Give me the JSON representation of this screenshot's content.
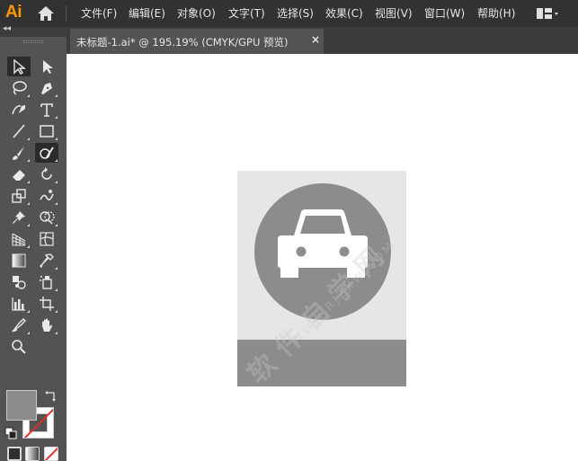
{
  "app": {
    "logo_text": "Ai",
    "home_icon": "home-icon"
  },
  "menu": {
    "items": [
      {
        "label": "文件(F)"
      },
      {
        "label": "编辑(E)"
      },
      {
        "label": "对象(O)"
      },
      {
        "label": "文字(T)"
      },
      {
        "label": "选择(S)"
      },
      {
        "label": "效果(C)"
      },
      {
        "label": "视图(V)"
      },
      {
        "label": "窗口(W)"
      },
      {
        "label": "帮助(H)"
      }
    ],
    "workspace_icon": "workspace-switcher-icon"
  },
  "toolpanel": {
    "collapse_label": "◂◂",
    "tools": [
      {
        "name": "selection-tool",
        "selected": true
      },
      {
        "name": "direct-selection-tool"
      },
      {
        "name": "magic-wand-tool"
      },
      {
        "name": "pen-tool"
      },
      {
        "name": "curvature-tool"
      },
      {
        "name": "type-tool"
      },
      {
        "name": "line-segment-tool"
      },
      {
        "name": "rectangle-tool"
      },
      {
        "name": "paintbrush-tool"
      },
      {
        "name": "shaper-tool",
        "selected": true
      },
      {
        "name": "eraser-tool"
      },
      {
        "name": "rotate-tool"
      },
      {
        "name": "scale-tool"
      },
      {
        "name": "warp-tool"
      },
      {
        "name": "puppet-warp-tool"
      },
      {
        "name": "shape-builder-tool"
      },
      {
        "name": "perspective-grid-tool"
      },
      {
        "name": "mesh-tool"
      },
      {
        "name": "gradient-tool"
      },
      {
        "name": "eyedropper-tool"
      },
      {
        "name": "blend-tool"
      },
      {
        "name": "symbol-sprayer-tool"
      },
      {
        "name": "column-graph-tool"
      },
      {
        "name": "artboard-tool"
      },
      {
        "name": "slice-tool"
      },
      {
        "name": "hand-tool"
      },
      {
        "name": "zoom-tool"
      }
    ],
    "fill_color": "#8c8c8c",
    "stroke_color": "none"
  },
  "document": {
    "tab_label": "未标题-1.ai* @ 195.19% (CMYK/GPU 预览)",
    "close_label": "×"
  },
  "artwork": {
    "artboard_color": "#e6e6e6",
    "shape_color": "#8c8c8c",
    "icon": "car-icon"
  },
  "watermark": {
    "main": "软件自学网",
    "sub": "WWW.RJZXW.COM"
  }
}
